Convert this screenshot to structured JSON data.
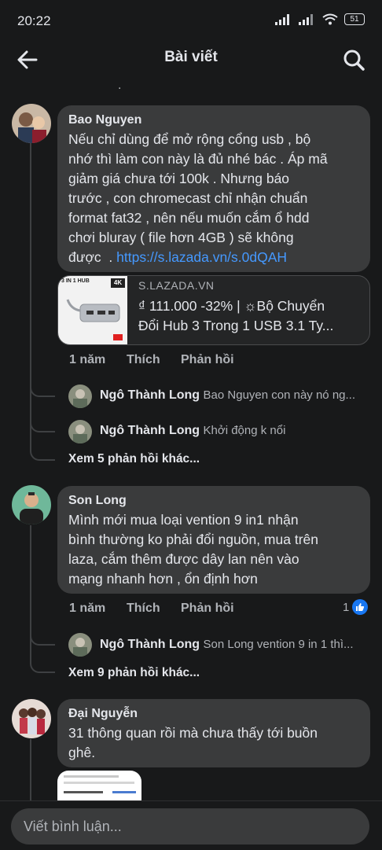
{
  "status": {
    "time": "20:22",
    "battery": "51"
  },
  "header": {
    "title": "Bài viết"
  },
  "top_fragment": ".",
  "comments": [
    {
      "author": "Bao Nguyen",
      "text_lines": [
        "Nếu chỉ dùng để mở rộng cổng usb , bộ",
        "nhớ thì làm con này là đủ nhé bác . Áp mã",
        "giảm giá chưa tới 100k . Nhưng báo",
        "trước , con chromecast chỉ nhận chuẩn",
        "format fat32 , nên nếu muốn cắm ổ hdd",
        "chơi bluray ( file hơn 4GB ) sẽ không"
      ],
      "last_line_prefix": "được  . ",
      "link": "https://s.lazada.vn/s.0dQAH",
      "preview": {
        "domain": "S.LAZADA.VN",
        "title_line1": "₫ 111.000 -32% | ☼Bộ Chuyển",
        "title_line2": "Đổi Hub 3 Trong 1 USB 3.1 Ty...",
        "thumb_label": "3 IN 1 HUB",
        "thumb_badge": "4K"
      },
      "time": "1 năm",
      "like": "Thích",
      "reply": "Phản hồi",
      "replies": [
        {
          "author": "Ngô Thành Long",
          "text": "Bao Nguyen  con này nó ng..."
        },
        {
          "author": "Ngô Thành Long",
          "text": "Khởi động k nổi"
        }
      ],
      "more": "Xem 5 phản hồi khác..."
    },
    {
      "author": "Son Long",
      "text_lines": [
        "Mình mới mua loại vention 9 in1 nhận",
        "bình thường ko phải đổi nguồn, mua trên",
        "laza, cắm thêm được dây lan nên vào",
        "mạng nhanh hơn , ổn định hơn"
      ],
      "time": "1 năm",
      "like": "Thích",
      "reply": "Phản hồi",
      "reaction_count": "1",
      "replies": [
        {
          "author": "Ngô Thành Long",
          "text": "Son Long  vention 9 in 1 thì..."
        }
      ],
      "more": "Xem 9 phản hồi khác..."
    },
    {
      "author": "Đại Nguyễn",
      "text_lines": [
        "31 thông quan rồi mà chưa thấy tới buồn",
        "ghê."
      ]
    }
  ],
  "composer": {
    "placeholder": "Viết bình luận..."
  },
  "colors": {
    "background": "#18191a",
    "bubble": "#3a3b3c",
    "link": "#4599ff",
    "like_blue": "#1877f2"
  }
}
